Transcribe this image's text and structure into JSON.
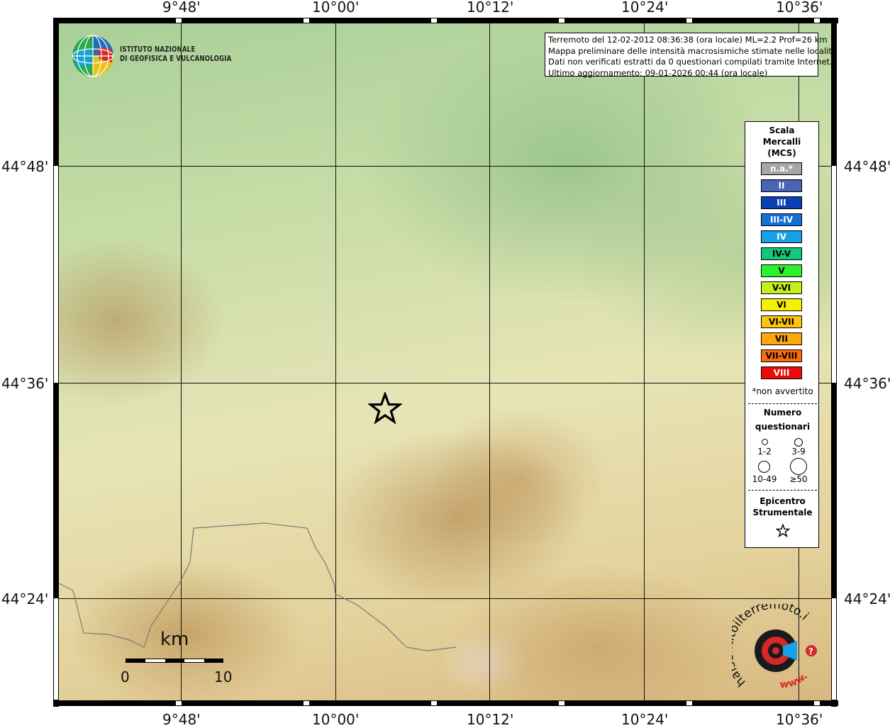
{
  "map": {
    "top_lon_labels": [
      "9°48'",
      "10°00'",
      "10°12'",
      "10°24'",
      "10°36'"
    ],
    "bottom_lon_labels": [
      "9°48'",
      "10°00'",
      "10°12'",
      "10°24'",
      "10°36'"
    ],
    "left_lat_labels": [
      "44°48'",
      "44°36'",
      "44°24'"
    ],
    "right_lat_labels": [
      "44°48'",
      "44°36'",
      "44°24'"
    ]
  },
  "logo": {
    "line1": "ISTITUTO NAZIONALE",
    "line2": "DI GEOFISICA E VULCANOLOGIA"
  },
  "info": {
    "line1": "Terremoto del 12-02-2012 08:36:38 (ora locale) ML=2.2 Prof=26 km",
    "line2": "Mappa preliminare delle intensità macrosismiche stimate nelle località",
    "line3": "Dati non verificati estratti da 0 questionari compilati tramite Internet.",
    "line4": "Ultimo aggiornamento: 09-01-2026 00:44 (ora locale)"
  },
  "legend": {
    "title_line1": "Scala",
    "title_line2": "Mercalli",
    "title_line3": "(MCS)",
    "scale": [
      {
        "label": "n.a.*",
        "color": "#a6a6a6",
        "text_color": "#ffffff"
      },
      {
        "label": "II",
        "color": "#4a63b4",
        "text_color": "#ffffff"
      },
      {
        "label": "III",
        "color": "#0b3fb4",
        "text_color": "#ffffff"
      },
      {
        "label": "III-IV",
        "color": "#1570d6",
        "text_color": "#ffffff"
      },
      {
        "label": "IV",
        "color": "#1aa0e6",
        "text_color": "#ffffff"
      },
      {
        "label": "IV-V",
        "color": "#13c878",
        "text_color": "#000000"
      },
      {
        "label": "V",
        "color": "#2cf12c",
        "text_color": "#000000"
      },
      {
        "label": "V-VI",
        "color": "#c3f01a",
        "text_color": "#000000"
      },
      {
        "label": "VI",
        "color": "#f8f000",
        "text_color": "#000000"
      },
      {
        "label": "VI-VII",
        "color": "#fcc40c",
        "text_color": "#000000"
      },
      {
        "label": "VII",
        "color": "#fca70c",
        "text_color": "#000000"
      },
      {
        "label": "VII-VIII",
        "color": "#fc6a0c",
        "text_color": "#000000"
      },
      {
        "label": "VIII",
        "color": "#ee0a0a",
        "text_color": "#ffffff"
      }
    ],
    "na_note": "*non avvertito",
    "questionnaires_title_1": "Numero",
    "questionnaires_title_2": "questionari",
    "sizes": [
      "1-2",
      "3-9",
      "10-49",
      "≥50"
    ],
    "epicenter_title_1": "Epicentro",
    "epicenter_title_2": "Strumentale",
    "epicenter_symbol": "☆"
  },
  "scalebar": {
    "unit": "km",
    "min": "0",
    "max": "10"
  },
  "epicenter_symbol": "☆",
  "badge": {
    "text_top": "haisentitoilterremoto.it",
    "text_bottom": "www."
  }
}
